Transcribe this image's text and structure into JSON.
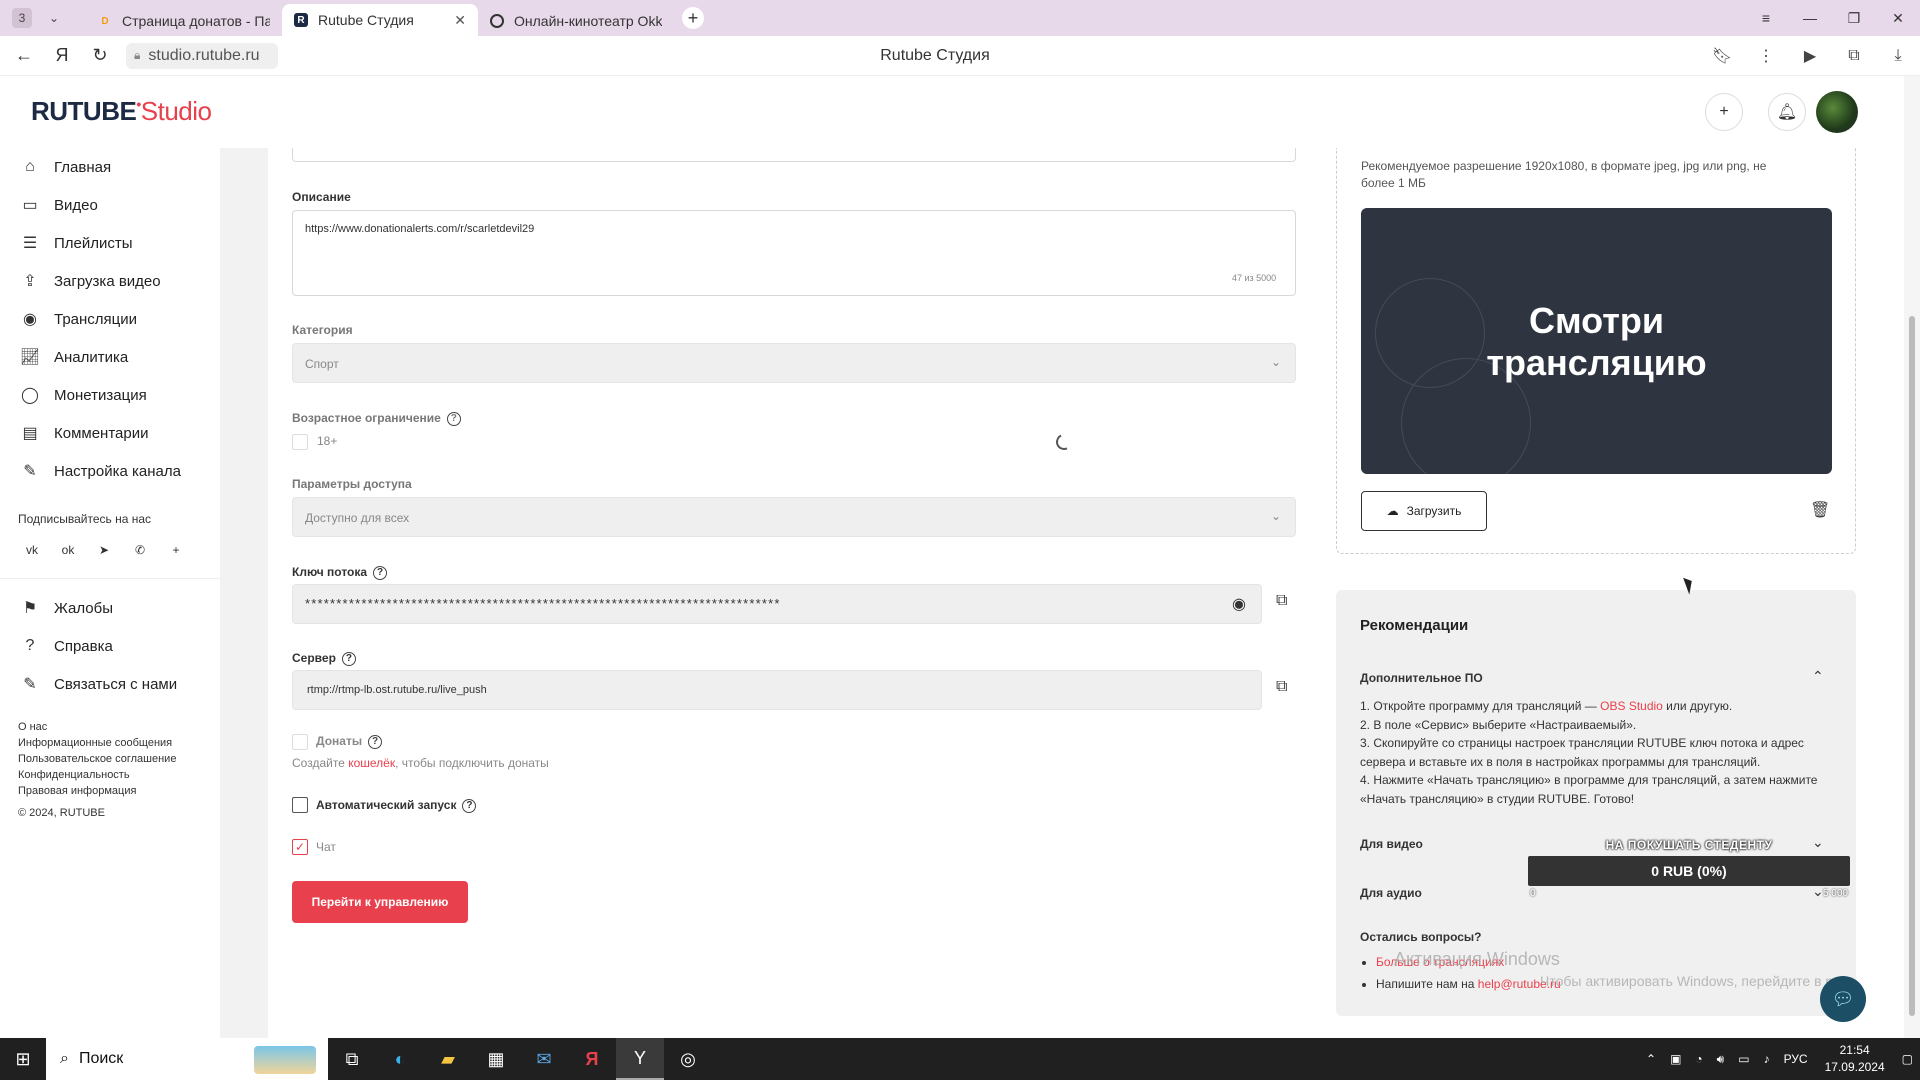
{
  "browser": {
    "tab_count": "3",
    "tabs": [
      {
        "label": "Страница донатов - Пане",
        "favicon": "D"
      },
      {
        "label": "Rutube Студия",
        "favicon": "R"
      },
      {
        "label": "Онлайн-кинотеатр Okko",
        "favicon": "O"
      }
    ],
    "url": "studio.rutube.ru",
    "page_title": "Rutube Студия"
  },
  "studio": {
    "logo_main": "RUTUBE",
    "logo_sub": "Studio"
  },
  "sidebar": {
    "items": [
      {
        "label": "Главная",
        "icon": "home-icon"
      },
      {
        "label": "Видео",
        "icon": "video-icon"
      },
      {
        "label": "Плейлисты",
        "icon": "playlist-icon"
      },
      {
        "label": "Загрузка видео",
        "icon": "upload-icon"
      },
      {
        "label": "Трансляции",
        "icon": "broadcast-icon"
      },
      {
        "label": "Аналитика",
        "icon": "analytics-icon"
      },
      {
        "label": "Монетизация",
        "icon": "monetization-icon"
      },
      {
        "label": "Комментарии",
        "icon": "comments-icon"
      },
      {
        "label": "Настройка канала",
        "icon": "channel-settings-icon"
      }
    ],
    "follow_title": "Подписывайтесь на нас",
    "socials": [
      "vk",
      "ok",
      "telegram",
      "viber",
      "more"
    ],
    "secondary_items": [
      {
        "label": "Жалобы",
        "icon": "flag-icon"
      },
      {
        "label": "Справка",
        "icon": "help-icon"
      },
      {
        "label": "Связаться с нами",
        "icon": "contact-icon"
      }
    ],
    "footer_links": [
      "О нас",
      "Информационные сообщения",
      "Пользовательское соглашение",
      "Конфиденциальность",
      "Правовая информация"
    ],
    "copyright": "© 2024, RUTUBE"
  },
  "form": {
    "description_label": "Описание",
    "description_value": "https://www.donationalerts.com/r/scarletdevil29",
    "description_counter": "47 из 5000",
    "category_label": "Категория",
    "category_value": "Спорт",
    "age_label": "Возрастное ограничение",
    "age_option": "18+",
    "access_label": "Параметры доступа",
    "access_value": "Доступно для всех",
    "stream_key_label": "Ключ потока",
    "stream_key_value": "****************************************************************************",
    "server_label": "Сервер",
    "server_value": "rtmp://rtmp-lb.ost.rutube.ru/live_push",
    "donations_label": "Донаты",
    "donations_hint_pre": "Создайте ",
    "donations_hint_link": "кошелёк",
    "donations_hint_post": ", чтобы подключить донаты",
    "autostart_label": "Автоматический запуск",
    "autostart_checked": false,
    "chat_label": "Чат",
    "chat_checked": true,
    "submit_label": "Перейти к управлению"
  },
  "cover": {
    "hint": "Рекомендуемое разрешение 1920x1080, в формате jpeg, jpg или png, не более 1 МБ",
    "preview_line1": "Смотри",
    "preview_line2": "трансляцию",
    "upload_label": "Загрузить"
  },
  "recommendations": {
    "title": "Рекомендации",
    "software_title": "Дополнительное ПО",
    "step1_pre": "1. Откройте программу для трансляций — ",
    "step1_link": "OBS Studio",
    "step1_post": " или другую.",
    "step2": "2. В поле «Сервис» выберите «Настраиваемый».",
    "step3": "3. Скопируйте со страницы настроек трансляции RUTUBE ключ потока и адрес сервера и вставьте их в поля в настройках программы для трансляций.",
    "step4": "4. Нажмите «Начать трансляцию» в программе для трансляций, а затем нажмите «Начать трансляцию» в студии RUTUBE. Готово!",
    "for_video": "Для видео",
    "for_audio": "Для аудио",
    "questions_title": "Остались вопросы?",
    "q1": "Больше о трансляциях",
    "q2_pre": "Напишите нам на ",
    "q2_link": "help@rutube.ru"
  },
  "donation_widget": {
    "goal_label": "НА ПОКУШАТЬ СТЕДЕНТУ",
    "amount": "0 RUB (0%)",
    "min": "0",
    "max": "5 000",
    "progress": 0
  },
  "windows": {
    "activate_title": "Активация Windows",
    "activate_hint": "Чтобы активировать Windows, перейдите в раздел \"Параметры\"",
    "search_placeholder": "Поиск",
    "lang": "РУС",
    "time": "21:54",
    "date": "17.09.2024"
  },
  "colors": {
    "accent": "#e8404c",
    "tab_bar": "#e8d9ea",
    "cover_bg": "#2f3441",
    "taskbar": "#202020"
  }
}
